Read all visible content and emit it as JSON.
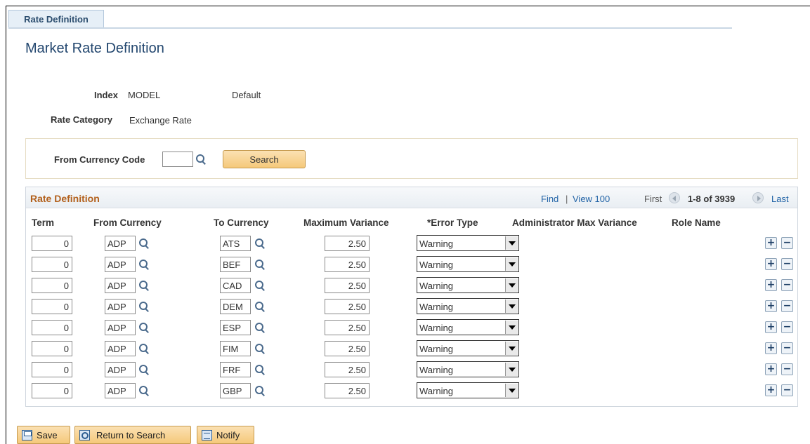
{
  "tab": {
    "label": "Rate Definition"
  },
  "page": {
    "title": "Market Rate Definition"
  },
  "info": {
    "index_label": "Index",
    "index_value": "MODEL",
    "index_desc": "Default",
    "category_label": "Rate Category",
    "category_value": "Exchange Rate"
  },
  "search": {
    "label": "From Currency Code",
    "value": "",
    "button_label": "Search"
  },
  "grid": {
    "title": "Rate Definition",
    "find_label": "Find",
    "separator": "|",
    "view_label": "View 100",
    "first_label": "First",
    "range_label": "1-8 of 3939",
    "last_label": "Last",
    "columns": {
      "term": "Term",
      "from_currency": "From Currency",
      "to_currency": "To Currency",
      "max_variance": "Maximum Variance",
      "error_type": "*Error Type",
      "admin_max_variance": "Administrator Max Variance",
      "role_name": "Role Name"
    },
    "rows": [
      {
        "term": "0",
        "from": "ADP",
        "to": "ATS",
        "variance": "2.50",
        "error_type": "Warning"
      },
      {
        "term": "0",
        "from": "ADP",
        "to": "BEF",
        "variance": "2.50",
        "error_type": "Warning"
      },
      {
        "term": "0",
        "from": "ADP",
        "to": "CAD",
        "variance": "2.50",
        "error_type": "Warning"
      },
      {
        "term": "0",
        "from": "ADP",
        "to": "DEM",
        "variance": "2.50",
        "error_type": "Warning"
      },
      {
        "term": "0",
        "from": "ADP",
        "to": "ESP",
        "variance": "2.50",
        "error_type": "Warning"
      },
      {
        "term": "0",
        "from": "ADP",
        "to": "FIM",
        "variance": "2.50",
        "error_type": "Warning"
      },
      {
        "term": "0",
        "from": "ADP",
        "to": "FRF",
        "variance": "2.50",
        "error_type": "Warning"
      },
      {
        "term": "0",
        "from": "ADP",
        "to": "GBP",
        "variance": "2.50",
        "error_type": "Warning"
      }
    ],
    "add_symbol": "+",
    "remove_symbol": "−"
  },
  "toolbar": {
    "save_label": "Save",
    "return_label": "Return to Search",
    "notify_label": "Notify",
    "save_icon": "save-icon",
    "return_icon": "return-to-search-icon",
    "notify_icon": "notify-icon"
  }
}
